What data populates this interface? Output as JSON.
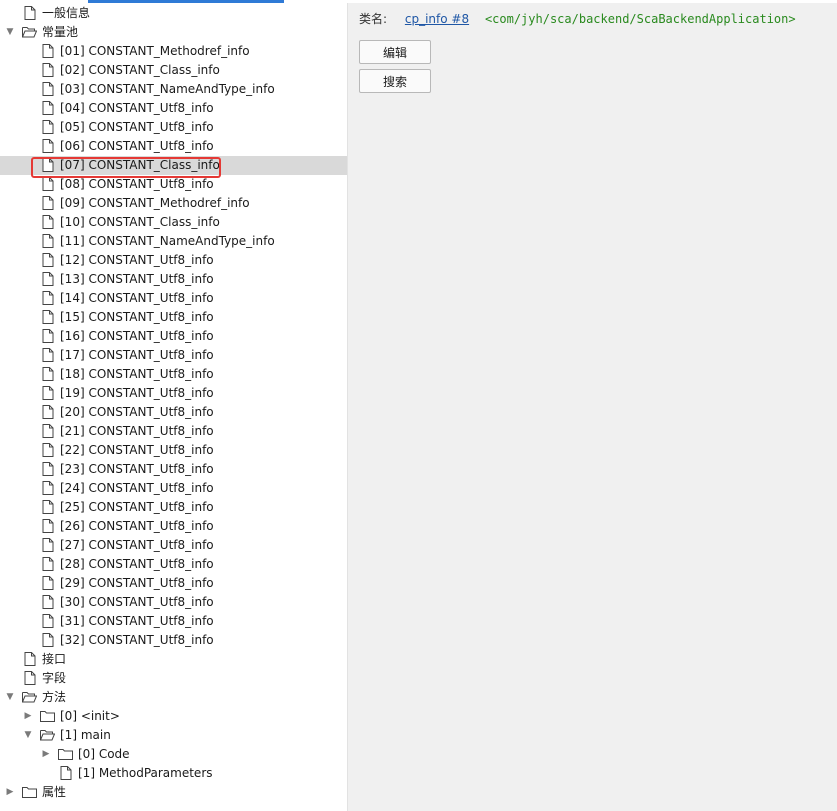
{
  "tree": {
    "general_info": "一般信息",
    "constant_pool": {
      "label": "常量池",
      "items": [
        "[01] CONSTANT_Methodref_info",
        "[02] CONSTANT_Class_info",
        "[03] CONSTANT_NameAndType_info",
        "[04] CONSTANT_Utf8_info",
        "[05] CONSTANT_Utf8_info",
        "[06] CONSTANT_Utf8_info",
        "[07] CONSTANT_Class_info",
        "[08] CONSTANT_Utf8_info",
        "[09] CONSTANT_Methodref_info",
        "[10] CONSTANT_Class_info",
        "[11] CONSTANT_NameAndType_info",
        "[12] CONSTANT_Utf8_info",
        "[13] CONSTANT_Utf8_info",
        "[14] CONSTANT_Utf8_info",
        "[15] CONSTANT_Utf8_info",
        "[16] CONSTANT_Utf8_info",
        "[17] CONSTANT_Utf8_info",
        "[18] CONSTANT_Utf8_info",
        "[19] CONSTANT_Utf8_info",
        "[20] CONSTANT_Utf8_info",
        "[21] CONSTANT_Utf8_info",
        "[22] CONSTANT_Utf8_info",
        "[23] CONSTANT_Utf8_info",
        "[24] CONSTANT_Utf8_info",
        "[25] CONSTANT_Utf8_info",
        "[26] CONSTANT_Utf8_info",
        "[27] CONSTANT_Utf8_info",
        "[28] CONSTANT_Utf8_info",
        "[29] CONSTANT_Utf8_info",
        "[30] CONSTANT_Utf8_info",
        "[31] CONSTANT_Utf8_info",
        "[32] CONSTANT_Utf8_info"
      ],
      "selected_index": 6
    },
    "interfaces": "接口",
    "fields": "字段",
    "methods": {
      "label": "方法",
      "init": "[0] <init>",
      "main": "[1] main",
      "main_code": "[0] Code",
      "main_params": "[1] MethodParameters"
    },
    "attributes": "属性"
  },
  "detail": {
    "class_title": "类名:",
    "cp_link": "cp_info #8",
    "class_desc": "<com/jyh/sca/backend/ScaBackendApplication>",
    "edit_label": "编辑",
    "search_label": "搜索"
  },
  "colors": {
    "accent": "#2f7ad6",
    "highlight": "#e53935",
    "link": "#1f57a6",
    "descriptor": "#2a8a1f",
    "selected_row": "#d9d9d9",
    "panel_bg": "#f0f0f0"
  },
  "icons": {
    "file": "file-icon",
    "folder_open": "folder-open-icon",
    "folder_closed": "folder-closed-icon",
    "expand": "chevron-right-icon",
    "collapse": "chevron-down-icon"
  }
}
